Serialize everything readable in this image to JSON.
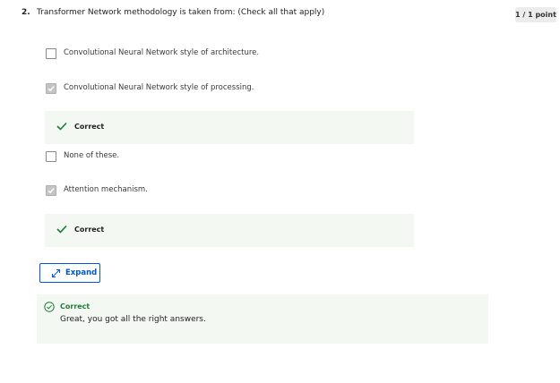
{
  "question": {
    "number": "2.",
    "text": "Transformer Network methodology is taken from: (Check all that apply)",
    "points": "1 / 1 point"
  },
  "options": [
    {
      "label": "Convolutional Neural Network style of architecture.",
      "checked": false
    },
    {
      "label": "Convolutional Neural Network style of processing.",
      "checked": true
    },
    {
      "label": "None of these.",
      "checked": false
    },
    {
      "label": "Attention mechanism.",
      "checked": true
    }
  ],
  "feedback": [
    {
      "label": "Correct"
    },
    {
      "label": "Correct"
    }
  ],
  "expand": {
    "label": "Expand"
  },
  "result": {
    "title": "Correct",
    "message": "Great, you got all the right answers."
  },
  "colors": {
    "accent": "#0056d2",
    "success": "#1f7a3a",
    "success_bg": "#f3f8f3"
  },
  "icons": {
    "check": "check-icon",
    "expand": "expand-arrows-icon",
    "result": "circle-check-icon"
  }
}
